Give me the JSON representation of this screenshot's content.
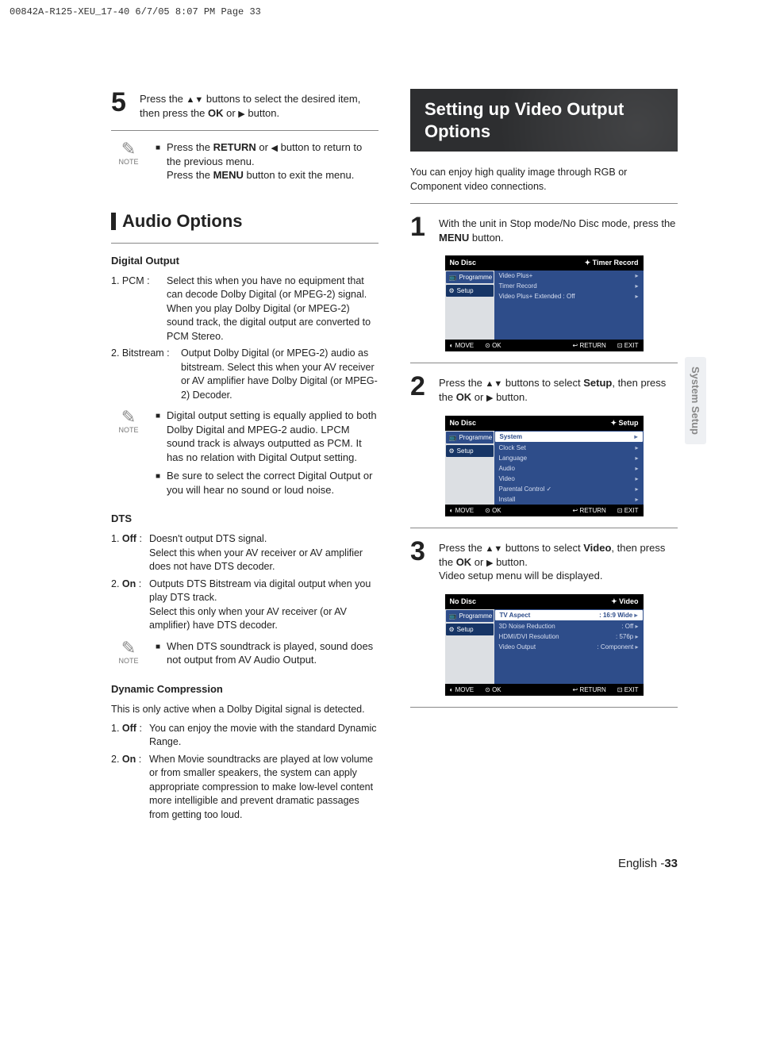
{
  "print_header": "00842A-R125-XEU_17-40  6/7/05  8:07 PM  Page 33",
  "side_tab": "System Setup",
  "left": {
    "step5_text_a": "Press the ",
    "step5_text_b": " buttons to select the desired item, then press the ",
    "step5_ok": "OK",
    "step5_text_c": " or ",
    "step5_text_d": " button.",
    "note1_a": "Press the ",
    "note1_return": "RETURN",
    "note1_b": " or ",
    "note1_c": " button to return to the previous menu.",
    "note1_d": "Press the ",
    "note1_menu": "MENU",
    "note1_e": " button to exit the menu.",
    "heading_audio": "Audio Options",
    "sub_digital": "Digital Output",
    "pcm_label": "1. PCM :",
    "pcm_text": "Select this when you have no equipment that can decode Dolby Digital (or MPEG-2) signal. When you play Dolby Digital (or MPEG-2) sound track, the digital output are converted to PCM Stereo.",
    "bitstream_label": "2. Bitstream :",
    "bitstream_text": "Output Dolby Digital (or MPEG-2) audio as bitstream. Select this when your AV receiver or AV amplifier have Dolby Digital (or MPEG-2) Decoder.",
    "note2_a": "Digital output setting is equally applied to both Dolby Digital and MPEG-2 audio. LPCM sound track is always outputted as PCM. It has no relation with Digital Output setting.",
    "note2_b": "Be sure to select the correct Digital Output or you will hear no sound or loud noise.",
    "sub_dts": "DTS",
    "dts_off_label": "1. Off :",
    "dts_off_a": "Doesn't output DTS signal.",
    "dts_off_b": "Select this when your AV receiver or AV amplifier does not have DTS decoder.",
    "dts_on_label": "2. On :",
    "dts_on_a": "Outputs DTS Bitstream via digital output when you play DTS track.",
    "dts_on_b": "Select this only when your AV receiver (or AV amplifier) have DTS decoder.",
    "note3": "When DTS soundtrack is played, sound does not output from AV Audio Output.",
    "sub_dyn": "Dynamic Compression",
    "dyn_intro": "This is only active when a Dolby Digital signal is detected.",
    "dyn_off_label": "1. Off :",
    "dyn_off": "You can enjoy the movie with the standard Dynamic Range.",
    "dyn_on_label": "2. On :",
    "dyn_on": "When Movie soundtracks are played at low volume or from smaller speakers, the system can apply appropriate compression to make low-level content more intelligible and prevent dramatic passages from getting too loud."
  },
  "right": {
    "heading": "Setting up Video Output Options",
    "intro": "You can enjoy high quality image through RGB or Component video connections.",
    "step1_a": "With the unit in Stop mode/No Disc mode, press the ",
    "step1_menu": "MENU",
    "step1_b": " button.",
    "step2_a": "Press the ",
    "step2_b": " buttons to select ",
    "step2_setup": "Setup",
    "step2_c": ", then press the ",
    "step2_ok": "OK",
    "step2_d": " or ",
    "step2_e": " button.",
    "step3_a": "Press the ",
    "step3_b": " buttons to select ",
    "step3_video": "Video",
    "step3_c": ", then press the ",
    "step3_ok": "OK",
    "step3_d": " or ",
    "step3_e": " button.",
    "step3_sub": "Video setup menu will be displayed.",
    "ss_common": {
      "no_disc": "No Disc",
      "prog": "Programme",
      "setup": "Setup",
      "foot_move": "MOVE",
      "foot_ok": "OK",
      "foot_return": "RETURN",
      "foot_exit": "EXIT"
    },
    "ss1": {
      "title_r": "Timer Record",
      "rows": [
        "Video Plus+",
        "Timer Record",
        "Video Plus+ Extended : Off"
      ]
    },
    "ss2": {
      "title_r": "Setup",
      "rows": [
        "System",
        "Clock Set",
        "Language",
        "Audio",
        "Video",
        "Parental Control ✓",
        "Install"
      ]
    },
    "ss3": {
      "title_r": "Video",
      "rows": [
        {
          "l": "TV Aspect",
          "r": ": 16:9 Wide"
        },
        {
          "l": "3D Noise Reduction",
          "r": ": Off"
        },
        {
          "l": "HDMI/DVI Resolution",
          "r": ": 576p"
        },
        {
          "l": "Video Output",
          "r": ": Component"
        }
      ]
    }
  },
  "note_label": "NOTE",
  "footer_lang": "English -",
  "footer_page": "33"
}
